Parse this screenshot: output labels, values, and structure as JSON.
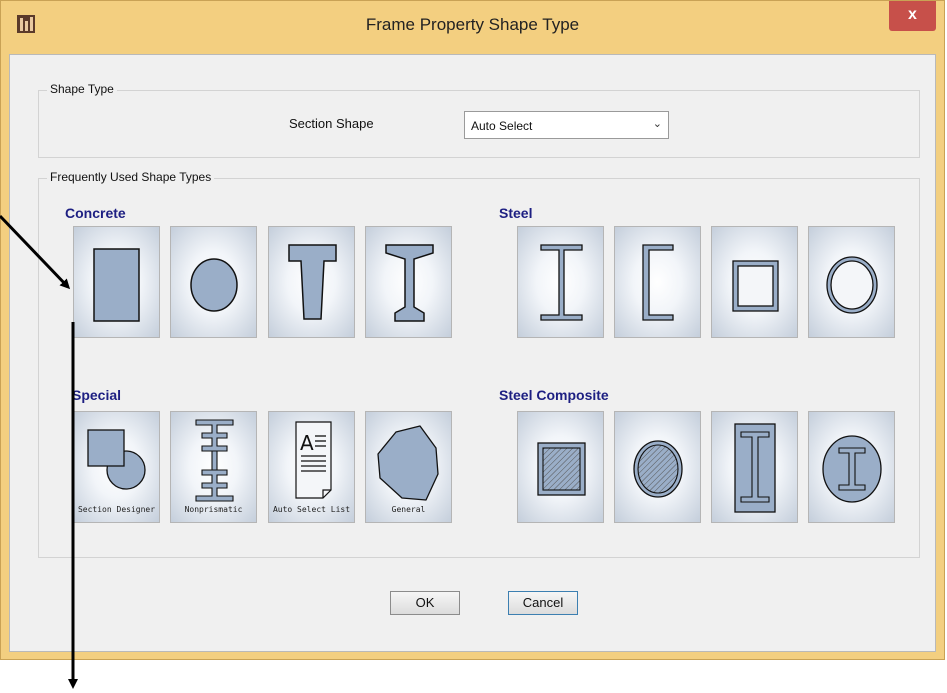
{
  "window": {
    "title": "Frame Property Shape Type",
    "close_label": "x"
  },
  "shape_type_group": {
    "label": "Shape Type",
    "section_shape_label": "Section Shape",
    "section_shape_value": "Auto Select"
  },
  "frequent_group": {
    "label": "Frequently Used Shape Types",
    "concrete": {
      "heading": "Concrete",
      "items": [
        "concrete-rectangular-icon",
        "concrete-circle-icon",
        "concrete-tee-icon",
        "concrete-i-girder-icon"
      ]
    },
    "steel": {
      "heading": "Steel",
      "items": [
        "steel-i-section-icon",
        "steel-channel-icon",
        "steel-box-icon",
        "steel-pipe-icon"
      ]
    },
    "special": {
      "heading": "Special",
      "items": [
        {
          "icon": "section-designer-icon",
          "caption": "Section Designer"
        },
        {
          "icon": "nonprismatic-icon",
          "caption": "Nonprismatic"
        },
        {
          "icon": "auto-select-list-icon",
          "caption": "Auto Select List"
        },
        {
          "icon": "general-icon",
          "caption": "General"
        }
      ]
    },
    "steel_composite": {
      "heading": "Steel Composite",
      "items": [
        "filled-box-icon",
        "filled-pipe-icon",
        "encased-rectangle-icon",
        "encased-circle-icon"
      ]
    }
  },
  "buttons": {
    "ok": "OK",
    "cancel": "Cancel"
  },
  "colors": {
    "title_bar": "#f3cf80",
    "close_button": "#c7504a",
    "shape_fill": "#9aaec8",
    "heading": "#1d1f82"
  }
}
